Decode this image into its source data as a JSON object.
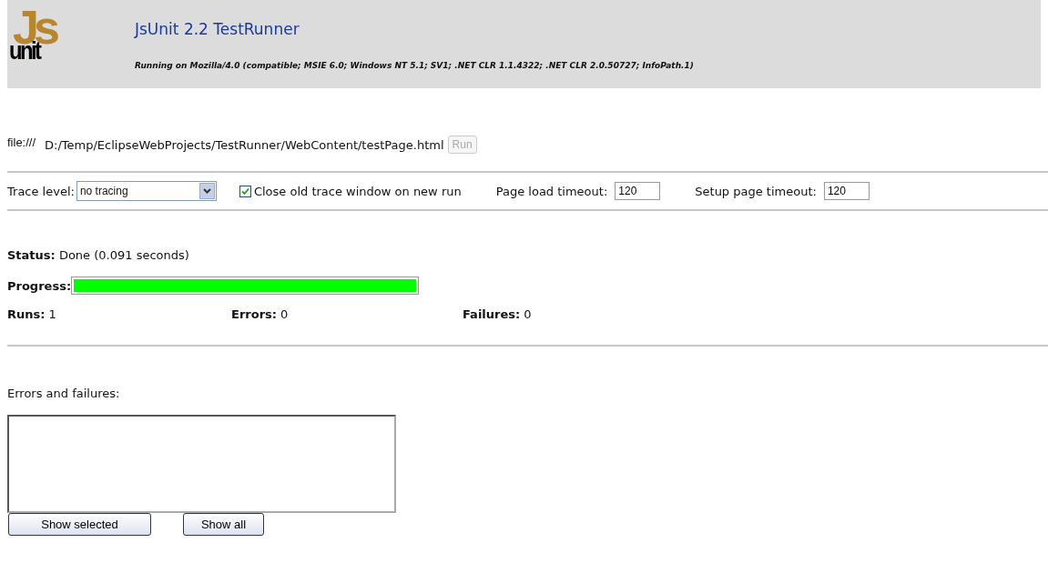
{
  "header": {
    "logo": {
      "back": "Js",
      "front": "unit"
    },
    "title": "JsUnit 2.2 TestRunner",
    "subtitle": "Running on Mozilla/4.0 (compatible; MSIE 6.0; Windows NT 5.1; SV1; .NET CLR 1.1.4322; .NET CLR 2.0.50727; InfoPath.1)"
  },
  "file": {
    "prefix": "file:///",
    "value": "D:/Temp/EclipseWebProjects/TestRunner/WebContent/testPage.html",
    "run_button": {
      "label": "Run",
      "disabled": true
    }
  },
  "options": {
    "trace_label": "Trace level:",
    "trace_value": "no tracing",
    "close_trace": {
      "label": "Close old trace window on new run",
      "checked": true
    },
    "page_load_label": "Page load timeout:",
    "page_load_value": "120",
    "setup_label": "Setup page timeout:",
    "setup_value": "120"
  },
  "status": {
    "label": "Status:",
    "value": "Done (0.091 seconds)"
  },
  "progress": {
    "label": "Progress:",
    "level": 1.0
  },
  "counts": [
    {
      "label": "Runs:",
      "value": "1"
    },
    {
      "label": "Errors:",
      "value": "0"
    },
    {
      "label": "Failures:",
      "value": "0"
    }
  ],
  "errors": {
    "label": "Errors and failures:",
    "buttons": [
      "Show selected",
      "Show all"
    ]
  }
}
